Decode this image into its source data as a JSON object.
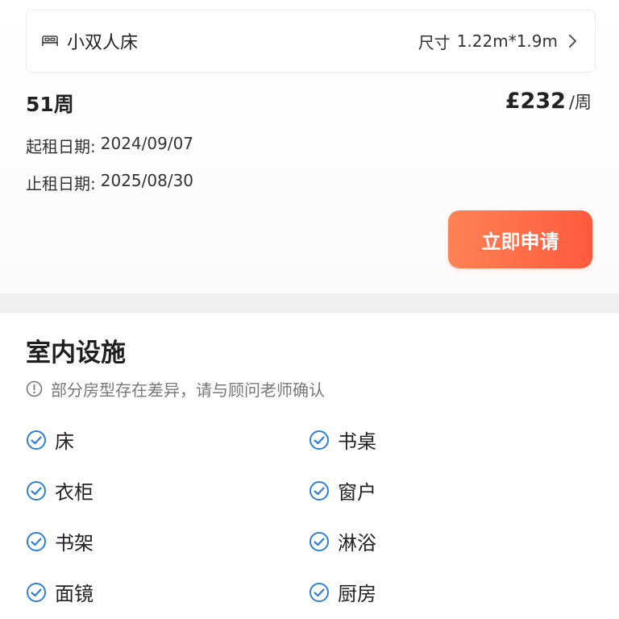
{
  "room": {
    "icon": "bed-icon",
    "name": "小双人床",
    "size_label": "尺寸",
    "size_value": "1.22m*1.9m",
    "chevron_icon": "chevron-right-icon"
  },
  "lease": {
    "weeks": "51周",
    "price": "£232",
    "price_unit": "/周",
    "start_label": "起租日期:",
    "start_date": "2024/09/07",
    "end_label": "止租日期:",
    "end_date": "2025/08/30"
  },
  "apply_button": {
    "label": "立即申请"
  },
  "colors": {
    "accent_start": "#ff8255",
    "accent_end": "#ff5a3d",
    "check_blue": "#2f7fd6",
    "divider": "#efefef"
  },
  "facilities": {
    "title": "室内设施",
    "notice": "部分房型存在差异，请与顾问老师确认",
    "notice_icon": "info-icon",
    "items": [
      {
        "label": "床",
        "icon": "check-circle-icon"
      },
      {
        "label": "书桌",
        "icon": "check-circle-icon"
      },
      {
        "label": "衣柜",
        "icon": "check-circle-icon"
      },
      {
        "label": "窗户",
        "icon": "check-circle-icon"
      },
      {
        "label": "书架",
        "icon": "check-circle-icon"
      },
      {
        "label": "淋浴",
        "icon": "check-circle-icon"
      },
      {
        "label": "面镜",
        "icon": "check-circle-icon"
      },
      {
        "label": "厨房",
        "icon": "check-circle-icon"
      }
    ]
  }
}
